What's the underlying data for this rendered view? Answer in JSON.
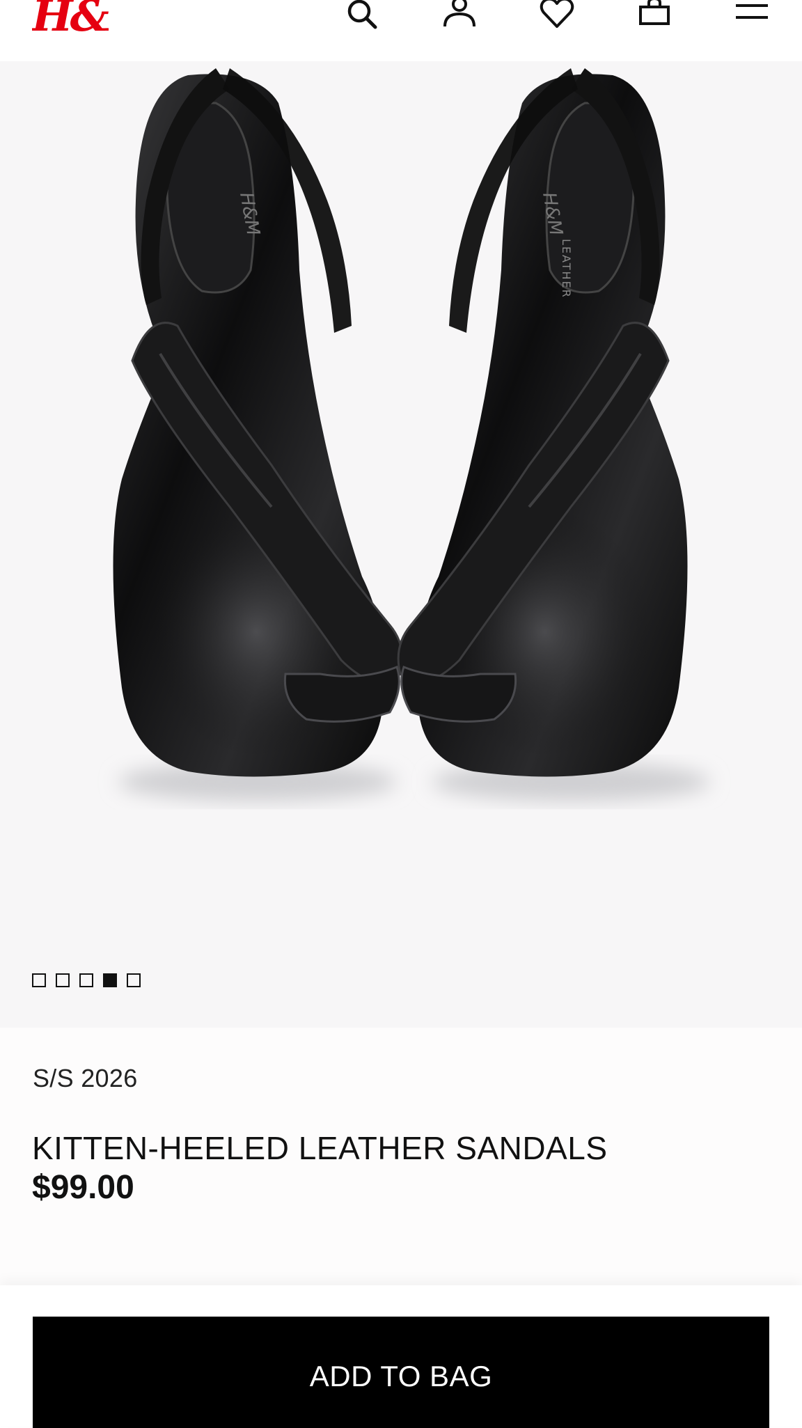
{
  "header": {
    "logo_text": "H&M",
    "icons": [
      "search-icon",
      "account-icon",
      "favorites-icon",
      "shopping-bag-icon",
      "menu-icon"
    ]
  },
  "gallery": {
    "image_count": 5,
    "active_index": 3
  },
  "product": {
    "season": "S/S 2026",
    "name": "KITTEN-HEELED LEATHER SANDALS",
    "price": "$99.00",
    "insole_label": "LEATHER"
  },
  "actions": {
    "add_to_bag_label": "ADD TO BAG"
  },
  "colors": {
    "brand_red": "#e50010",
    "button_black": "#000000",
    "hero_bg": "#f7f6f7"
  }
}
